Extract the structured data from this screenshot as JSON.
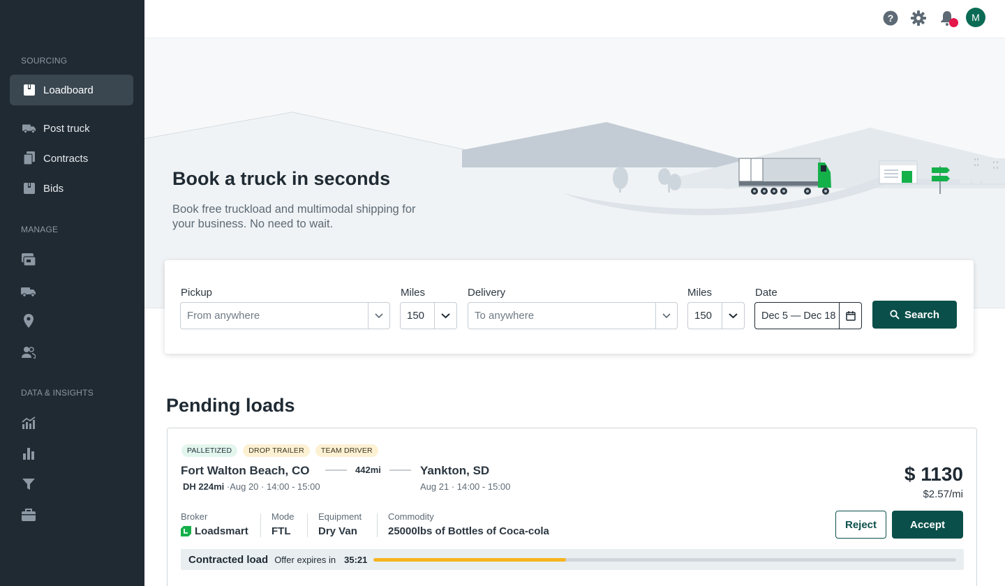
{
  "sidebar": {
    "sections": [
      "SOURCING",
      "MANAGE",
      "DATA & INSIGHTS"
    ],
    "sourcing_items": [
      {
        "label": "Loadboard",
        "icon": "loadboard-icon",
        "active": true
      },
      {
        "label": "Post truck",
        "icon": "truck-icon"
      },
      {
        "label": "Contracts",
        "icon": "contracts-icon"
      },
      {
        "label": "Bids",
        "icon": "bids-icon"
      }
    ],
    "manage_icons": [
      "shipments-icon",
      "fleet-icon",
      "location-pin-icon",
      "users-icon"
    ],
    "insights_icons": [
      "trend-chart-icon",
      "bar-chart-icon",
      "filter-icon",
      "briefcase-icon"
    ]
  },
  "topbar": {
    "icons": [
      "help-icon",
      "settings-gear-icon",
      "bell-icon"
    ],
    "avatar_initial": "M",
    "has_notification": true
  },
  "hero": {
    "title": "Book a truck in seconds",
    "subtitle": "Book free truckload and multimodal shipping for your business.  No need to wait."
  },
  "search": {
    "pickup_label": "Pickup",
    "pickup_placeholder": "From anywhere",
    "pickup_miles_label": "Miles",
    "pickup_miles": "150",
    "delivery_label": "Delivery",
    "delivery_placeholder": "To anywhere",
    "delivery_miles_label": "Miles",
    "delivery_miles": "150",
    "date_label": "Date",
    "date_value": "Dec 5 — Dec 18",
    "button_label": "Search"
  },
  "pending": {
    "title": "Pending loads",
    "load": {
      "tags": [
        "PALLETIZED",
        "DROP TRAILER",
        "TEAM DRIVER"
      ],
      "origin": "Fort Walton Beach, CO",
      "deadhead": "DH 224mi",
      "origin_time": "·Aug 20 · 14:00 - 15:00",
      "distance": "442mi",
      "destination": "Yankton, SD",
      "destination_time": "Aug 21 · 14:00 - 15:00",
      "price": "$ 1130",
      "rate_per_mile": "$2.57/mi",
      "broker_label": "Broker",
      "broker": "Loadsmart",
      "mode_label": "Mode",
      "mode": "FTL",
      "equipment_label": "Equipment",
      "equipment": "Dry Van",
      "commodity_label": "Commodity",
      "commodity": "25000lbs of Bottles of Coca-cola",
      "reject_label": "Reject",
      "accept_label": "Accept",
      "contracted_label": "Contracted load",
      "offer_expires_label": "Offer expires in",
      "offer_timer": "35:21",
      "offer_progress": 0.33
    }
  },
  "colors": {
    "sidebar_bg": "#202a33",
    "primary": "#0b4f4a",
    "accent_green": "#14b04a",
    "progress": "#f5b41f",
    "notification": "#e4174b"
  }
}
